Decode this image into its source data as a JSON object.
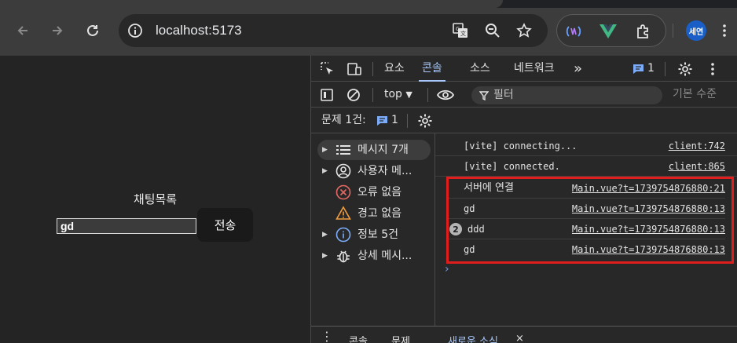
{
  "browser": {
    "url": "localhost:5173",
    "profile_initials": "세연",
    "icons": [
      "back-arrow-icon",
      "forward-arrow-icon",
      "reload-icon",
      "site-info-icon",
      "translate-icon",
      "zoom-icon",
      "bookmark-star-icon",
      "extension-wave-icon",
      "vue-devtools-icon",
      "puzzle-icon",
      "kebab-menu-icon"
    ]
  },
  "page": {
    "chat_title": "채팅목록",
    "input_value": "gd",
    "send_label": "전송"
  },
  "devtools": {
    "tabs": [
      {
        "label": "요소",
        "active": false
      },
      {
        "label": "콘솔",
        "active": true
      },
      {
        "label": "소스",
        "active": false
      },
      {
        "label": "네트워크",
        "active": false
      }
    ],
    "more_tabs": "»",
    "issue_count": "1",
    "context": "top",
    "filter_placeholder": "필터",
    "levels_label": "기본 수준",
    "issues_label": "문제 1건:",
    "issues_count_small": "1",
    "sidebar": [
      {
        "label": "메시지 7개",
        "icon": "list-icon",
        "has_arrow": true,
        "selected": true
      },
      {
        "label": "사용자 메...",
        "icon": "user-icon",
        "has_arrow": true,
        "selected": false
      },
      {
        "label": "오류 없음",
        "icon": "error-icon",
        "has_arrow": false,
        "selected": false
      },
      {
        "label": "경고 없음",
        "icon": "warning-icon",
        "has_arrow": false,
        "selected": false
      },
      {
        "label": "정보 5건",
        "icon": "info-icon",
        "has_arrow": true,
        "selected": false
      },
      {
        "label": "상세 메시...",
        "icon": "bug-icon",
        "has_arrow": true,
        "selected": false
      }
    ],
    "logs": [
      {
        "message": "[vite] connecting...",
        "source": "client:742",
        "count": ""
      },
      {
        "message": "[vite] connected.",
        "source": "client:865",
        "count": ""
      },
      {
        "message": "서버에 연결",
        "source": "Main.vue?t=1739754876880:21",
        "count": ""
      },
      {
        "message": "gd",
        "source": "Main.vue?t=1739754876880:13",
        "count": ""
      },
      {
        "message": "ddd",
        "source": "Main.vue?t=1739754876880:13",
        "count": "2"
      },
      {
        "message": "gd",
        "source": "Main.vue?t=1739754876880:13",
        "count": ""
      }
    ],
    "prompt": "›",
    "drawer_tabs": [
      {
        "label": "콘솔",
        "active": false
      },
      {
        "label": "문제",
        "active": false
      },
      {
        "label": "새로운 소식",
        "active": true
      }
    ],
    "drawer_close": "×",
    "highlight_color": "#e01e1e",
    "accent_color": "#a8c7fa"
  }
}
